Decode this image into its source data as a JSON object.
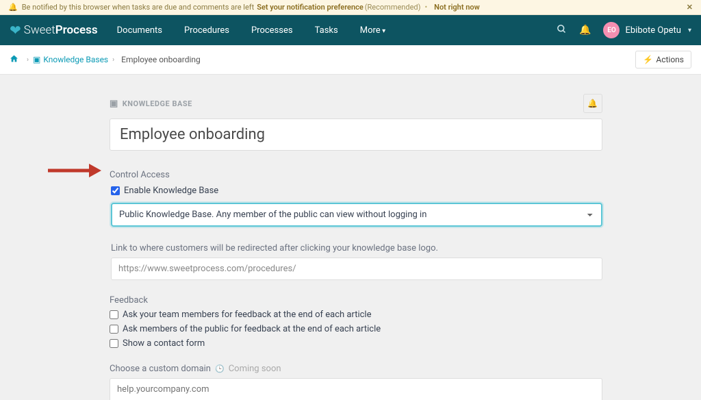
{
  "banner": {
    "text": "Be notified by this browser when tasks are due and comments are left",
    "link1": "Set your notification preference",
    "rec": "(Recommended)",
    "link2": "Not right now"
  },
  "logo": {
    "sweet": "Sweet",
    "process": "Process"
  },
  "nav": {
    "documents": "Documents",
    "procedures": "Procedures",
    "processes": "Processes",
    "tasks": "Tasks",
    "more": "More"
  },
  "user": {
    "initials": "EO",
    "name": "Ebibote Opetu"
  },
  "crumb": {
    "kb": "Knowledge Bases",
    "current": "Employee onboarding",
    "actions": "Actions"
  },
  "section": {
    "label": "KNOWLEDGE BASE"
  },
  "title": "Employee onboarding",
  "control": {
    "label": "Control Access",
    "enable": "Enable Knowledge Base",
    "selected": "Public Knowledge Base. Any member of the public can view without logging in",
    "linkhelp": "Link to where customers will be redirected after clicking your knowledge base logo.",
    "linkval": "https://www.sweetprocess.com/procedures/"
  },
  "feedback": {
    "label": "Feedback",
    "opt1": "Ask your team members for feedback at the end of each article",
    "opt2": "Ask members of the public for feedback at the end of each article",
    "opt3": "Show a contact form"
  },
  "domain": {
    "label": "Choose a custom domain",
    "soon": "Coming soon",
    "placeholder": "help.yourcompany.com"
  }
}
